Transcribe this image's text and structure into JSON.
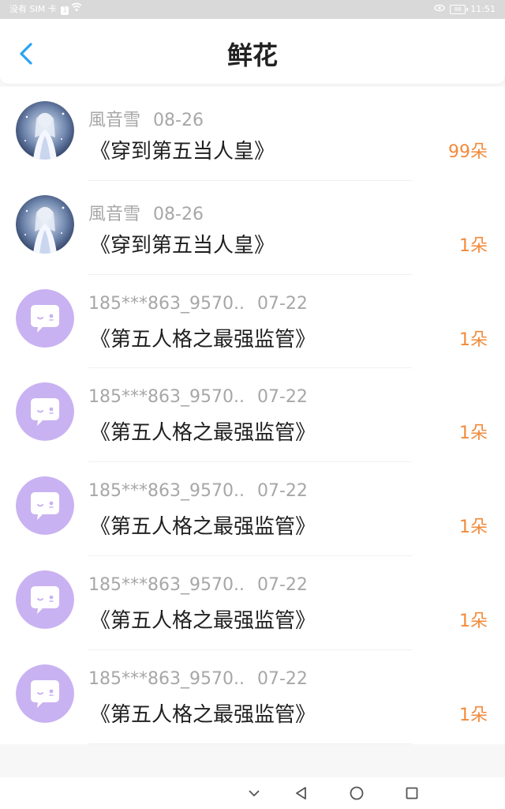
{
  "status": {
    "carrier": "没有 SIM 卡",
    "sim_badge": "1",
    "battery": "86",
    "time": "11:51"
  },
  "header": {
    "title": "鲜花",
    "back_icon": "chevron-left-icon"
  },
  "items": [
    {
      "name": "風音雪",
      "date": "08-26",
      "book": "《穿到第五当人皇》",
      "count": "99朵",
      "avatar": "anime-avatar"
    },
    {
      "name": "風音雪",
      "date": "08-26",
      "book": "《穿到第五当人皇》",
      "count": "1朵",
      "avatar": "anime-avatar"
    },
    {
      "name": "185***863_9570..",
      "date": "07-22",
      "book": "《第五人格之最强监管》",
      "count": "1朵",
      "avatar": "default-chat-avatar"
    },
    {
      "name": "185***863_9570..",
      "date": "07-22",
      "book": "《第五人格之最强监管》",
      "count": "1朵",
      "avatar": "default-chat-avatar"
    },
    {
      "name": "185***863_9570..",
      "date": "07-22",
      "book": "《第五人格之最强监管》",
      "count": "1朵",
      "avatar": "default-chat-avatar"
    },
    {
      "name": "185***863_9570..",
      "date": "07-22",
      "book": "《第五人格之最强监管》",
      "count": "1朵",
      "avatar": "default-chat-avatar"
    },
    {
      "name": "185***863_9570..",
      "date": "07-22",
      "book": "《第五人格之最强监管》",
      "count": "1朵",
      "avatar": "default-chat-avatar"
    }
  ],
  "colors": {
    "accent": "#2aa3f3",
    "count": "#f28a3a",
    "avatar_purple": "#c9b2f2"
  },
  "navbar": {
    "buttons": [
      "chevron-down-icon",
      "back-triangle-icon",
      "home-circle-icon",
      "recents-square-icon"
    ]
  }
}
